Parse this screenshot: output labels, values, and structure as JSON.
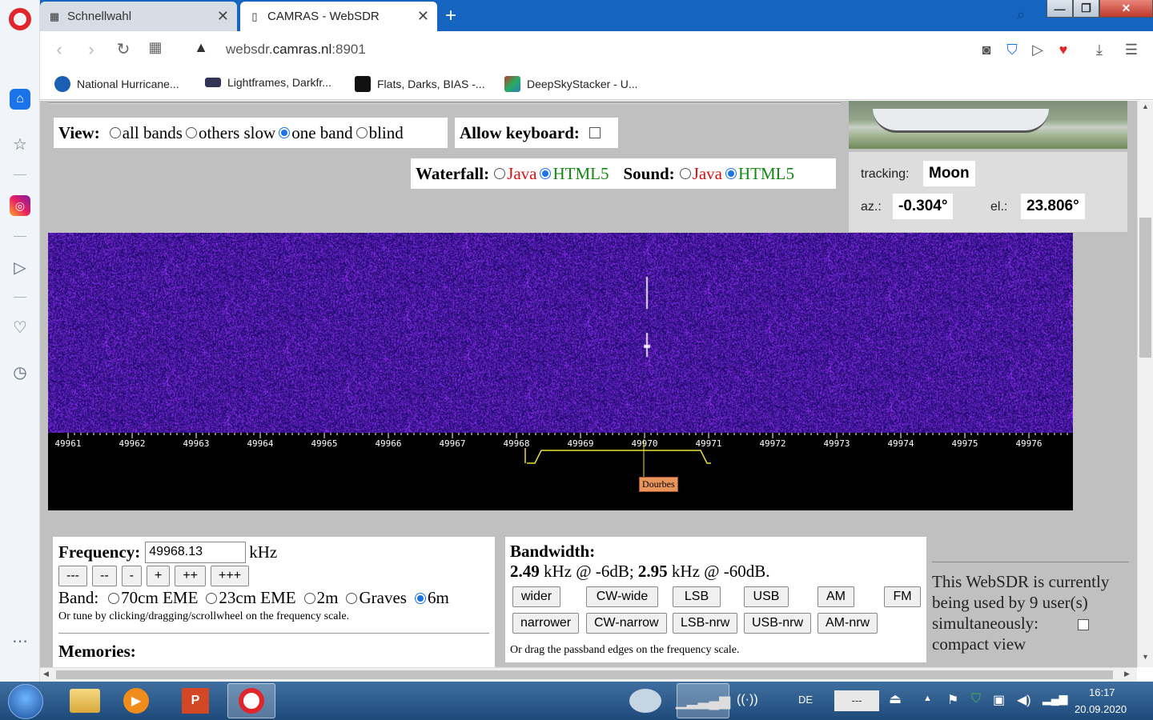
{
  "browser": {
    "tabs": [
      {
        "label": "Schnellwahl"
      },
      {
        "label": "CAMRAS - WebSDR"
      }
    ],
    "url_host": "websdr.",
    "url_domain": "camras.nl",
    "url_port": ":8901",
    "bookmarks": [
      {
        "label": "National Hurricane...",
        "color": "#1a5fb4"
      },
      {
        "label": "Lightframes, Darkfr...",
        "color": "#333355"
      },
      {
        "label": "Flats, Darks, BIAS -...",
        "color": "#111111"
      },
      {
        "label": "DeepSkyStacker - U...",
        "color": "#c0392b"
      }
    ]
  },
  "view": {
    "label": "View:",
    "options": [
      "all bands",
      "others slow",
      "one band",
      "blind"
    ],
    "selected": "one band",
    "keyboard_label": "Allow keyboard:"
  },
  "audio": {
    "waterfall_label": "Waterfall:",
    "sound_label": "Sound:",
    "java": "Java",
    "html5": "HTML5"
  },
  "tracking": {
    "label": "tracking:",
    "target": "Moon",
    "az_label": "az.:",
    "az_value": "-0.304°",
    "el_label": "el.:",
    "el_value": "23.806°"
  },
  "scale": {
    "ticks": [
      "49961",
      "49962",
      "49963",
      "49964",
      "49965",
      "49966",
      "49967",
      "49968",
      "49969",
      "49970",
      "49971",
      "49972",
      "49973",
      "49974",
      "49975",
      "49976"
    ],
    "station": "Dourbes"
  },
  "frequency": {
    "label": "Frequency:",
    "value": "49968.13",
    "unit": "kHz",
    "step_buttons": [
      "---",
      "--",
      "-",
      "+",
      "++",
      "+++"
    ],
    "band_label": "Band:",
    "bands": [
      "70cm EME",
      "23cm EME",
      "2m",
      "Graves",
      "6m"
    ],
    "selected_band": "6m",
    "hint": "Or tune by clicking/dragging/scrollwheel on the frequency scale.",
    "memories_label": "Memories:"
  },
  "bandwidth": {
    "label": "Bandwidth:",
    "bw6": "2.49",
    "bw6_suffix": " kHz @ -6dB; ",
    "bw60": "2.95",
    "bw60_suffix": " kHz @ -60dB.",
    "row1": [
      "wider",
      "CW-wide",
      "LSB",
      "USB",
      "AM",
      "FM"
    ],
    "row2": [
      "narrower",
      "CW-narrow",
      "LSB-nrw",
      "USB-nrw",
      "AM-nrw"
    ],
    "hint": "Or drag the passband edges on the frequency scale."
  },
  "users": {
    "text": "This WebSDR is currently being used by 9 user(s) simultaneously:",
    "compact_label": "compact view"
  },
  "taskbar": {
    "lang": "DE",
    "time": "16:17",
    "date": "20.09.2020",
    "input_text": "---"
  },
  "colors": {
    "tabstrip": "#1565c0",
    "waterfall": "#3a1a90",
    "passband": "#e8e030"
  }
}
